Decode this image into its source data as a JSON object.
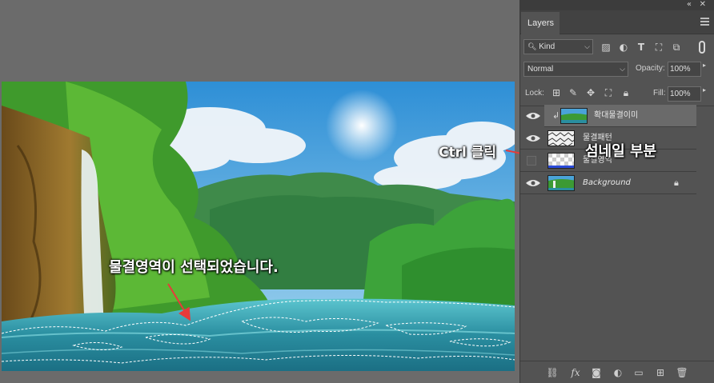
{
  "annotations": {
    "ctrl_click": "Ctrl 클릭",
    "thumbnail_part": "섬네일 부분",
    "selection_done": "물결영역이 선택되었습니다."
  },
  "panel": {
    "tab_label": "Layers",
    "filter": {
      "kind_label": "Kind"
    },
    "blend_mode": "Normal",
    "opacity_label": "Opacity:",
    "opacity_value": "100%",
    "lock_label": "Lock:",
    "fill_label": "Fill:",
    "fill_value": "100%"
  },
  "layers": [
    {
      "name": "확대물결이미",
      "visible": true,
      "selected": true,
      "clipped": true
    },
    {
      "name": "물결패턴",
      "visible": true,
      "selected": false,
      "clipped": false
    },
    {
      "name": "물결영역",
      "visible": false,
      "selected": false,
      "clipped": false
    },
    {
      "name": "Background",
      "visible": true,
      "selected": false,
      "clipped": false,
      "locked": true
    }
  ],
  "icons": {
    "filter": [
      "image-filter-icon",
      "adjustment-filter-icon",
      "type-filter-icon",
      "shape-filter-icon",
      "smart-object-filter-icon"
    ],
    "lock": [
      "lock-transparent-icon",
      "lock-image-icon",
      "lock-position-icon",
      "lock-artboard-icon",
      "lock-all-icon"
    ],
    "bottom": [
      "link-layers-icon",
      "fx-icon",
      "add-mask-icon",
      "adjustment-layer-icon",
      "new-group-icon",
      "new-layer-icon",
      "delete-layer-icon"
    ]
  },
  "colors": {
    "annotation_arrow": "#e83a3a",
    "panel_bg": "#535353",
    "workspace_bg": "#6b6b6b",
    "selected_layer": "#6a6a6a"
  }
}
